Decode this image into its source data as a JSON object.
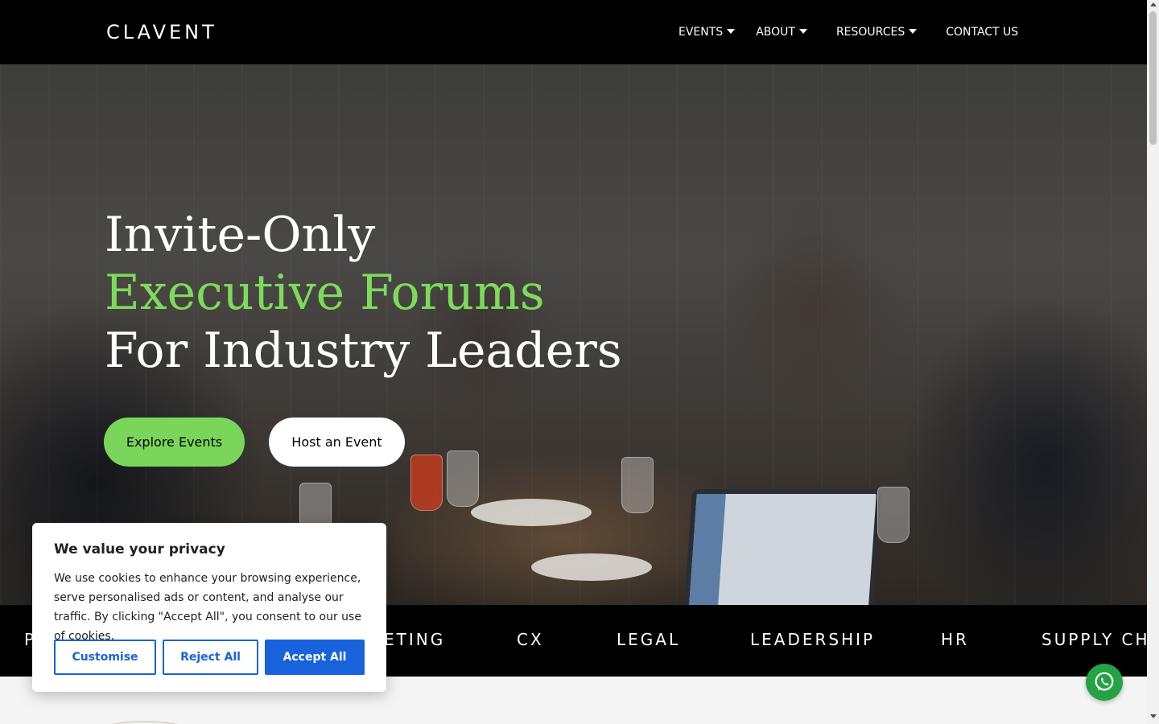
{
  "header": {
    "logo": "CLAVENT",
    "nav": [
      {
        "label": "EVENTS",
        "has_dropdown": true
      },
      {
        "label": "ABOUT",
        "has_dropdown": true
      },
      {
        "label": "RESOURCES",
        "has_dropdown": true
      },
      {
        "label": "CONTACT US",
        "has_dropdown": false
      }
    ]
  },
  "hero": {
    "title_line1": "Invite-Only",
    "title_line2": "Executive Forums",
    "title_line3": "For Industry Leaders",
    "accent_color": "#7ddb5c",
    "primary_button": "Explore Events",
    "secondary_button": "Host an Event"
  },
  "ticker": {
    "items": [
      "P",
      "ETING",
      "CX",
      "LEGAL",
      "LEADERSHIP",
      "HR",
      "SUPPLY CHA"
    ]
  },
  "cookie_banner": {
    "title": "We value your privacy",
    "text": "We use cookies to enhance your browsing experience, serve personalised ads or content, and analyse our traffic. By clicking \"Accept All\", you consent to our use of cookies.",
    "customise": "Customise",
    "reject": "Reject All",
    "accept": "Accept All",
    "accent_color": "#1863dc"
  },
  "floating": {
    "whatsapp_icon": "whatsapp-icon",
    "whatsapp_color": "#25a244"
  }
}
